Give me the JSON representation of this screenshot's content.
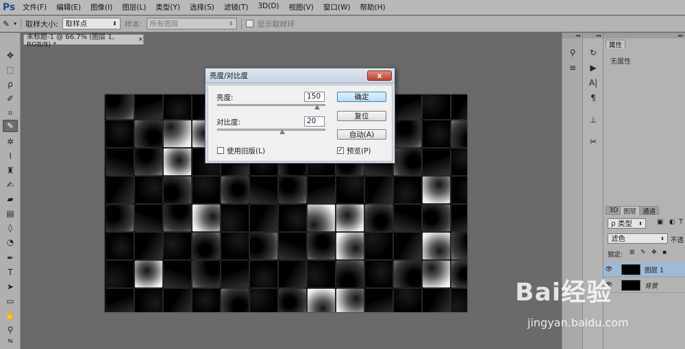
{
  "app": {
    "logo": "Ps"
  },
  "menu": [
    "文件(F)",
    "编辑(E)",
    "图像(I)",
    "图层(L)",
    "类型(Y)",
    "选择(S)",
    "滤镜(T)",
    "3D(D)",
    "视图(V)",
    "窗口(W)",
    "帮助(H)"
  ],
  "options": {
    "sample_size_label": "取样大小:",
    "sample_size_value": "取样点",
    "sample_label": "样本:",
    "sample_value": "所有图层",
    "show_ring_label": "显示取样环"
  },
  "document": {
    "tab_title": "未标题-1 @ 66.7% (图层 1, RGB/8) *",
    "close": "×"
  },
  "dialog": {
    "title": "亮度/对比度",
    "close": "x",
    "brightness_label": "亮度:",
    "brightness_value": "150",
    "brightness_fraction": 0.925,
    "contrast_label": "对比度:",
    "contrast_value": "20",
    "contrast_fraction": 0.6,
    "use_legacy_label": "使用旧版(L)",
    "use_legacy_checked": false,
    "ok_label": "确定",
    "reset_label": "复位",
    "auto_label": "自动(A)",
    "preview_label": "预览(P)",
    "preview_checked": true
  },
  "panels": {
    "properties_tab": "属性",
    "properties_empty": "无属性",
    "tabs": [
      "3D",
      "图层",
      "通道"
    ],
    "kind_filter": "ρ 类型",
    "blend_mode": "滤色",
    "opacity_label": "不透",
    "lock_label": "锁定:",
    "layers": [
      {
        "name": "图层 1",
        "selected": true
      },
      {
        "name": "背景",
        "selected": false
      }
    ]
  },
  "watermark": {
    "brand": "Bai经验",
    "url": "jingyan.baidu.com"
  }
}
